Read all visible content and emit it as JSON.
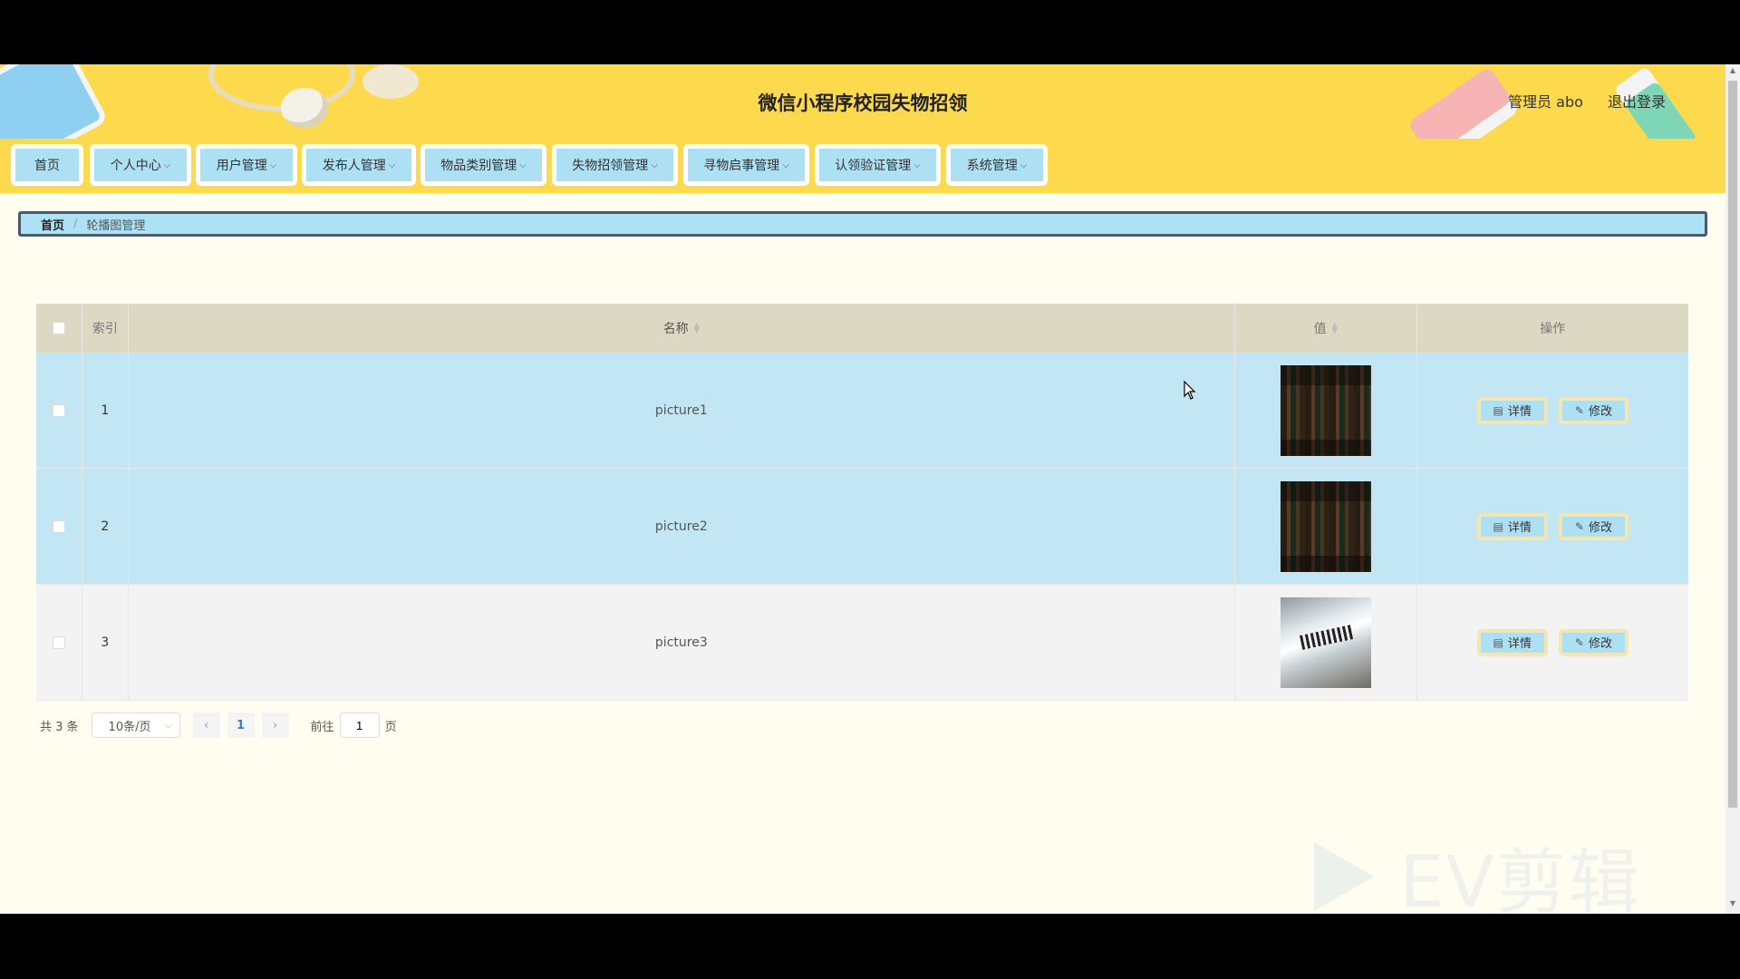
{
  "header": {
    "app_title": "微信小程序校园失物招领",
    "user_label": "管理员 abo",
    "logout_label": "退出登录"
  },
  "nav": {
    "items": [
      {
        "label": "首页",
        "dropdown": false
      },
      {
        "label": "个人中心",
        "dropdown": true
      },
      {
        "label": "用户管理",
        "dropdown": true
      },
      {
        "label": "发布人管理",
        "dropdown": true
      },
      {
        "label": "物品类别管理",
        "dropdown": true
      },
      {
        "label": "失物招领管理",
        "dropdown": true
      },
      {
        "label": "寻物启事管理",
        "dropdown": true
      },
      {
        "label": "认领验证管理",
        "dropdown": true
      },
      {
        "label": "系统管理",
        "dropdown": true
      }
    ]
  },
  "breadcrumb": {
    "home": "首页",
    "separator": "/",
    "current": "轮播图管理"
  },
  "table": {
    "columns": {
      "index": "索引",
      "name": "名称",
      "value": "值",
      "actions": "操作"
    },
    "rows": [
      {
        "index": "1",
        "name": "picture1",
        "image": "books-photo"
      },
      {
        "index": "2",
        "name": "picture2",
        "image": "books-photo"
      },
      {
        "index": "3",
        "name": "picture3",
        "image": "box-photo"
      }
    ],
    "detail_label": "详情",
    "edit_label": "修改"
  },
  "pagination": {
    "total_text": "共 3 条",
    "page_size": "10条/页",
    "current_page": "1",
    "goto_label": "前往",
    "goto_value": "1",
    "page_suffix": "页"
  },
  "watermark": {
    "text": "EV剪辑"
  },
  "colors": {
    "header_bg": "#fdd94d",
    "nav_button_bg": "#aee0f4",
    "row_highlight": "#c3e6f5",
    "page_bg": "#fffdf0"
  }
}
